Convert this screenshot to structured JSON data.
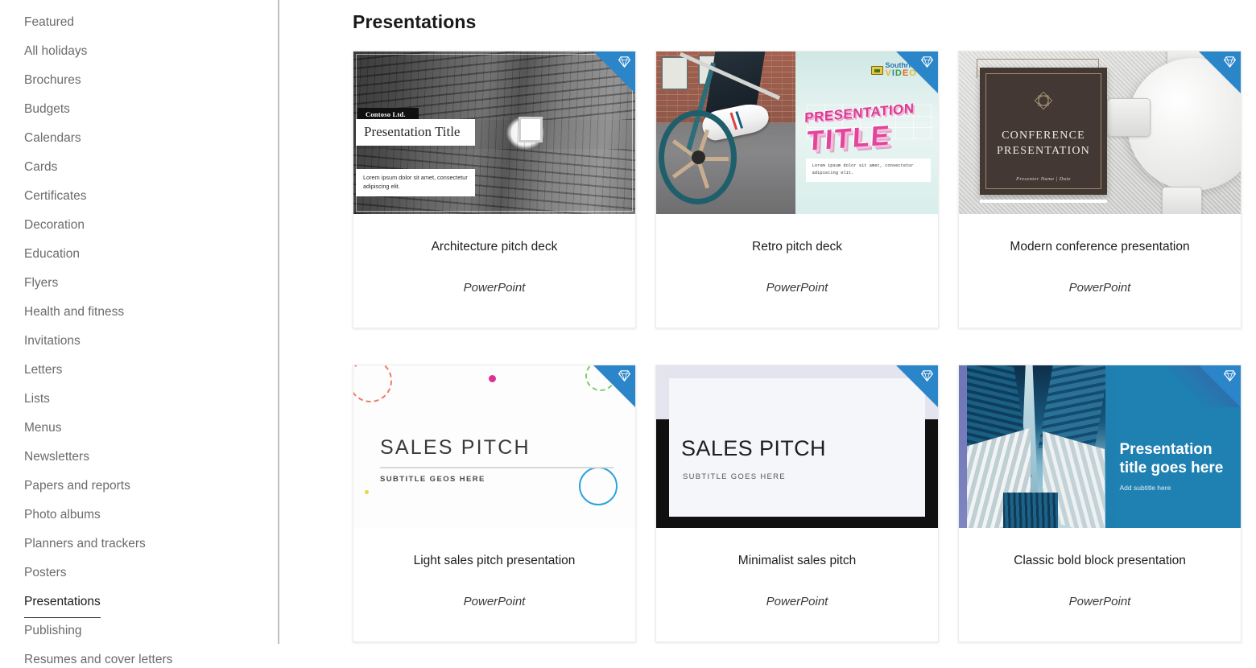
{
  "sidebar": {
    "items": [
      {
        "label": "Featured",
        "selected": false
      },
      {
        "label": "All holidays",
        "selected": false
      },
      {
        "label": "Brochures",
        "selected": false
      },
      {
        "label": "Budgets",
        "selected": false
      },
      {
        "label": "Calendars",
        "selected": false
      },
      {
        "label": "Cards",
        "selected": false
      },
      {
        "label": "Certificates",
        "selected": false
      },
      {
        "label": "Decoration",
        "selected": false
      },
      {
        "label": "Education",
        "selected": false
      },
      {
        "label": "Flyers",
        "selected": false
      },
      {
        "label": "Health and fitness",
        "selected": false
      },
      {
        "label": "Invitations",
        "selected": false
      },
      {
        "label": "Letters",
        "selected": false
      },
      {
        "label": "Lists",
        "selected": false
      },
      {
        "label": "Menus",
        "selected": false
      },
      {
        "label": "Newsletters",
        "selected": false
      },
      {
        "label": "Papers and reports",
        "selected": false
      },
      {
        "label": "Photo albums",
        "selected": false
      },
      {
        "label": "Planners and trackers",
        "selected": false
      },
      {
        "label": "Posters",
        "selected": false
      },
      {
        "label": "Presentations",
        "selected": true
      },
      {
        "label": "Publishing",
        "selected": false
      },
      {
        "label": "Resumes and cover letters",
        "selected": false
      }
    ]
  },
  "main": {
    "title": "Presentations",
    "cards": [
      {
        "title": "Architecture pitch deck",
        "app": "PowerPoint",
        "premium": true,
        "badge_icon": "diamond-icon",
        "thumb": {
          "brand": "Contoso Ltd.",
          "headline": "Presentation Title",
          "body": "Lorem ipsum dolor sit amet, consectetur adipiscing elit."
        }
      },
      {
        "title": "Retro pitch deck",
        "app": "PowerPoint",
        "premium": true,
        "badge_icon": "diamond-icon",
        "thumb": {
          "logo_top": "Southridge",
          "logo_bottom": "VIDEO",
          "headline_line1": "PRESENTATION",
          "headline_line2": "TITLE",
          "body": "Lorem ipsum dolor sit amet, consectetur adipiscing elit."
        }
      },
      {
        "title": "Modern conference presentation",
        "app": "PowerPoint",
        "premium": true,
        "badge_icon": "diamond-icon",
        "thumb": {
          "headline_line1": "CONFERENCE",
          "headline_line2": "PRESENTATION",
          "byline": "Presenter Name | Date"
        }
      },
      {
        "title": "Light sales pitch presentation",
        "app": "PowerPoint",
        "premium": true,
        "badge_icon": "diamond-icon",
        "thumb": {
          "headline": "SALES PITCH",
          "subtitle": "SUBTITLE GEOS HERE"
        }
      },
      {
        "title": "Minimalist sales pitch",
        "app": "PowerPoint",
        "premium": true,
        "badge_icon": "diamond-icon",
        "thumb": {
          "headline": "SALES PITCH",
          "subtitle": "SUBTITLE GOES HERE"
        }
      },
      {
        "title": "Classic bold block presentation",
        "app": "PowerPoint",
        "premium": true,
        "badge_icon": "diamond-icon",
        "thumb": {
          "headline_line1": "Presentation",
          "headline_line2": "title goes here",
          "subtitle": "Add subtitle here"
        }
      }
    ]
  },
  "colors": {
    "premium_badge": "#2b85c9",
    "selected_nav_text": "#1a1a1a",
    "nav_text": "#6b6b6b",
    "divider": "#bfbfbf"
  }
}
